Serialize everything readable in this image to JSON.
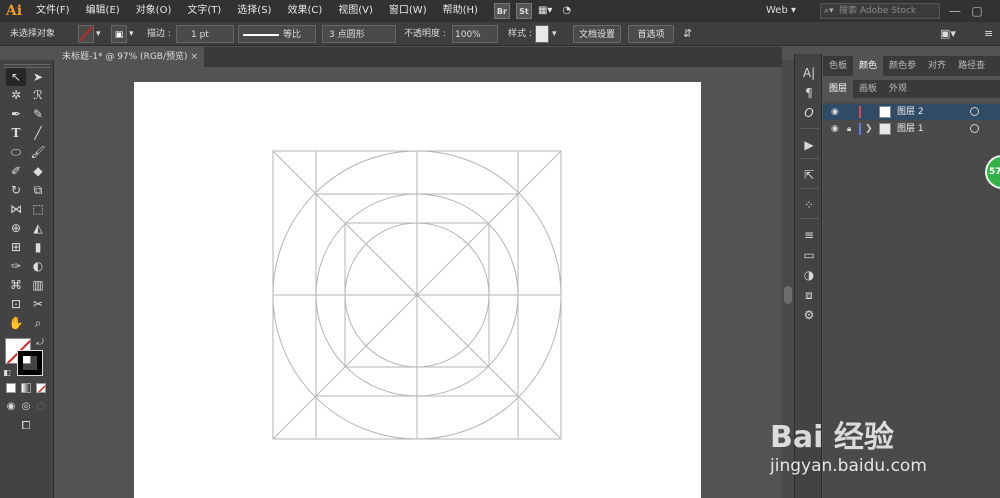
{
  "app": {
    "logo": "Ai",
    "menu": [
      "文件(F)",
      "编辑(E)",
      "对象(O)",
      "文字(T)",
      "选择(S)",
      "效果(C)",
      "视图(V)",
      "窗口(W)",
      "帮助(H)"
    ],
    "bridge": "Br",
    "stock": "St",
    "workspace": "Web",
    "search_placeholder": "搜索 Adobe Stock"
  },
  "control": {
    "selection": "未选择对象",
    "stroke_label": "描边 :",
    "stroke_value": "1 pt",
    "profile": "等比",
    "brush": "3 点圆形",
    "opacity_label": "不透明度 :",
    "opacity_value": "100%",
    "style_label": "样式 :",
    "doc_setup": "文档设置",
    "prefs": "首选项"
  },
  "document": {
    "tab_title": "未标题-1* @ 97% (RGB/预览)",
    "close": "×"
  },
  "panels": {
    "tabs_top": [
      "色板",
      "颜色",
      "颜色参",
      "对齐",
      "路径查"
    ],
    "active_top": 1,
    "tabs_layers": [
      "图层",
      "画板",
      "外观"
    ],
    "layers": [
      {
        "name": "图层 2",
        "color": "#e0494b",
        "selected": true,
        "locked": false
      },
      {
        "name": "图层 1",
        "color": "#5b7fe0",
        "selected": false,
        "locked": true
      }
    ]
  },
  "badge": "57",
  "watermark": {
    "brand": "Bai 经验",
    "url": "jingyan.baidu.com"
  }
}
